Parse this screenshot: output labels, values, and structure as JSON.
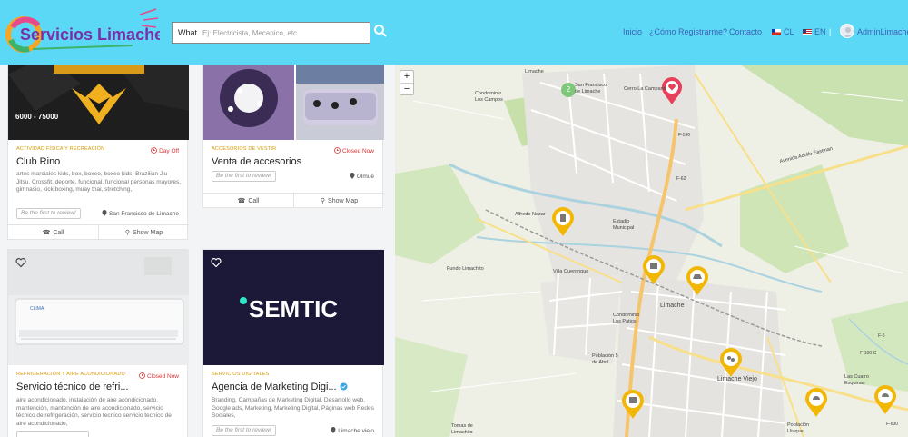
{
  "header": {
    "logo_text": "Servicios Limache",
    "search_label": "What",
    "search_placeholder": "Ej: Electricista, Mecanico, etc",
    "nav": [
      "Inicio",
      "¿Cómo Registrarme?",
      "Contacto"
    ],
    "lang_cl": "CL",
    "lang_en": "EN",
    "user": "AdminLimache"
  },
  "listings": [
    {
      "price": "6000 - 75000",
      "category": "Actividad Física y Recreación",
      "status": "Day Off",
      "title": "Club Rino",
      "description": "artes marciales kids, box, boxeo, boxeo kids, Brazilian Jiu-Jitsu, Crossfit, deporte, funcional, funcional personas mayores, gimnasio, kick boxing, muay thai, stretching,",
      "review": "Be the first to review!",
      "location": "San Francisco de Limache",
      "call": "Call",
      "showmap": "Show Map"
    },
    {
      "category": "Accesorios de Vestir",
      "status": "Closed Now",
      "title": "Venta de accesorios",
      "review": "Be the first to review!",
      "location": "Olmué",
      "call": "Call",
      "showmap": "Show Map"
    },
    {
      "category": "Refrigeración y Aire Acondicionado",
      "status": "Closed Now",
      "title": "Servicio técnico de refri...",
      "description": "aire acondicionado, instalación de aire acondicionado, mantención, mantención de aire acondicionado, servicio técnico de refrigeración, servicio tecnico servicio tecnico de aire acondicionado,",
      "unit_brand": "CLIMA"
    },
    {
      "banner": "SEMTIC",
      "category": "Servicios Digitales",
      "title": "Agencia de Marketing Digi...",
      "description": "Branding, Campañas de Marketing Digital, Desarrollo web, Google ads, Marketing, Marketing Digital, Páginas web Redes Sociales,",
      "review": "Be the first to review!",
      "location": "Limache viejo"
    }
  ],
  "map": {
    "zoom_in": "+",
    "zoom_out": "−",
    "cluster_count": "2",
    "labels": [
      "Limache",
      "San Francisco de Limache",
      "Condominio Los Campos",
      "Cerro La Campana",
      "Avenida Adolfo Eastman",
      "Alfredo Nazar",
      "Fundo Limachito",
      "Villa Queronque",
      "Limache",
      "Limache Viejo",
      "Condominio Los Patios",
      "Población 5 de Abril",
      "Las Cuatro Esquinas",
      "Población Lliuque",
      "Tomas de Limachito",
      "Estadio Municipal",
      "F-590",
      "F-62",
      "F-100-G",
      "F-630",
      "F-5"
    ]
  },
  "colors": {
    "header_bg": "#5ad8f5",
    "nav_link": "#3f5fb5",
    "category": "#d69b00",
    "status_closed": "#dd3333",
    "marker": "#f2b705",
    "marker_active": "#e8405a"
  }
}
